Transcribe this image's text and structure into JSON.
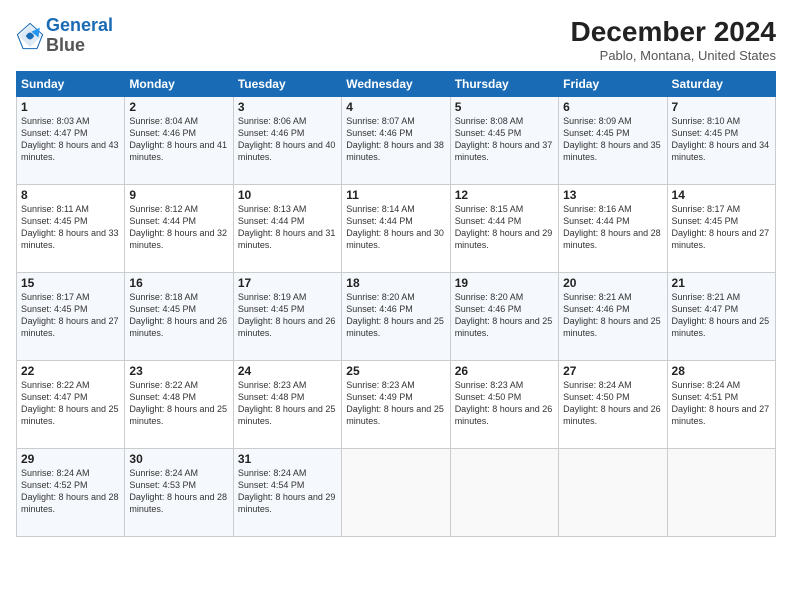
{
  "logo": {
    "line1": "General",
    "line2": "Blue"
  },
  "header": {
    "title": "December 2024",
    "subtitle": "Pablo, Montana, United States"
  },
  "weekdays": [
    "Sunday",
    "Monday",
    "Tuesday",
    "Wednesday",
    "Thursday",
    "Friday",
    "Saturday"
  ],
  "weeks": [
    [
      {
        "day": "1",
        "sunrise": "Sunrise: 8:03 AM",
        "sunset": "Sunset: 4:47 PM",
        "daylight": "Daylight: 8 hours and 43 minutes."
      },
      {
        "day": "2",
        "sunrise": "Sunrise: 8:04 AM",
        "sunset": "Sunset: 4:46 PM",
        "daylight": "Daylight: 8 hours and 41 minutes."
      },
      {
        "day": "3",
        "sunrise": "Sunrise: 8:06 AM",
        "sunset": "Sunset: 4:46 PM",
        "daylight": "Daylight: 8 hours and 40 minutes."
      },
      {
        "day": "4",
        "sunrise": "Sunrise: 8:07 AM",
        "sunset": "Sunset: 4:46 PM",
        "daylight": "Daylight: 8 hours and 38 minutes."
      },
      {
        "day": "5",
        "sunrise": "Sunrise: 8:08 AM",
        "sunset": "Sunset: 4:45 PM",
        "daylight": "Daylight: 8 hours and 37 minutes."
      },
      {
        "day": "6",
        "sunrise": "Sunrise: 8:09 AM",
        "sunset": "Sunset: 4:45 PM",
        "daylight": "Daylight: 8 hours and 35 minutes."
      },
      {
        "day": "7",
        "sunrise": "Sunrise: 8:10 AM",
        "sunset": "Sunset: 4:45 PM",
        "daylight": "Daylight: 8 hours and 34 minutes."
      }
    ],
    [
      {
        "day": "8",
        "sunrise": "Sunrise: 8:11 AM",
        "sunset": "Sunset: 4:45 PM",
        "daylight": "Daylight: 8 hours and 33 minutes."
      },
      {
        "day": "9",
        "sunrise": "Sunrise: 8:12 AM",
        "sunset": "Sunset: 4:44 PM",
        "daylight": "Daylight: 8 hours and 32 minutes."
      },
      {
        "day": "10",
        "sunrise": "Sunrise: 8:13 AM",
        "sunset": "Sunset: 4:44 PM",
        "daylight": "Daylight: 8 hours and 31 minutes."
      },
      {
        "day": "11",
        "sunrise": "Sunrise: 8:14 AM",
        "sunset": "Sunset: 4:44 PM",
        "daylight": "Daylight: 8 hours and 30 minutes."
      },
      {
        "day": "12",
        "sunrise": "Sunrise: 8:15 AM",
        "sunset": "Sunset: 4:44 PM",
        "daylight": "Daylight: 8 hours and 29 minutes."
      },
      {
        "day": "13",
        "sunrise": "Sunrise: 8:16 AM",
        "sunset": "Sunset: 4:44 PM",
        "daylight": "Daylight: 8 hours and 28 minutes."
      },
      {
        "day": "14",
        "sunrise": "Sunrise: 8:17 AM",
        "sunset": "Sunset: 4:45 PM",
        "daylight": "Daylight: 8 hours and 27 minutes."
      }
    ],
    [
      {
        "day": "15",
        "sunrise": "Sunrise: 8:17 AM",
        "sunset": "Sunset: 4:45 PM",
        "daylight": "Daylight: 8 hours and 27 minutes."
      },
      {
        "day": "16",
        "sunrise": "Sunrise: 8:18 AM",
        "sunset": "Sunset: 4:45 PM",
        "daylight": "Daylight: 8 hours and 26 minutes."
      },
      {
        "day": "17",
        "sunrise": "Sunrise: 8:19 AM",
        "sunset": "Sunset: 4:45 PM",
        "daylight": "Daylight: 8 hours and 26 minutes."
      },
      {
        "day": "18",
        "sunrise": "Sunrise: 8:20 AM",
        "sunset": "Sunset: 4:46 PM",
        "daylight": "Daylight: 8 hours and 25 minutes."
      },
      {
        "day": "19",
        "sunrise": "Sunrise: 8:20 AM",
        "sunset": "Sunset: 4:46 PM",
        "daylight": "Daylight: 8 hours and 25 minutes."
      },
      {
        "day": "20",
        "sunrise": "Sunrise: 8:21 AM",
        "sunset": "Sunset: 4:46 PM",
        "daylight": "Daylight: 8 hours and 25 minutes."
      },
      {
        "day": "21",
        "sunrise": "Sunrise: 8:21 AM",
        "sunset": "Sunset: 4:47 PM",
        "daylight": "Daylight: 8 hours and 25 minutes."
      }
    ],
    [
      {
        "day": "22",
        "sunrise": "Sunrise: 8:22 AM",
        "sunset": "Sunset: 4:47 PM",
        "daylight": "Daylight: 8 hours and 25 minutes."
      },
      {
        "day": "23",
        "sunrise": "Sunrise: 8:22 AM",
        "sunset": "Sunset: 4:48 PM",
        "daylight": "Daylight: 8 hours and 25 minutes."
      },
      {
        "day": "24",
        "sunrise": "Sunrise: 8:23 AM",
        "sunset": "Sunset: 4:48 PM",
        "daylight": "Daylight: 8 hours and 25 minutes."
      },
      {
        "day": "25",
        "sunrise": "Sunrise: 8:23 AM",
        "sunset": "Sunset: 4:49 PM",
        "daylight": "Daylight: 8 hours and 25 minutes."
      },
      {
        "day": "26",
        "sunrise": "Sunrise: 8:23 AM",
        "sunset": "Sunset: 4:50 PM",
        "daylight": "Daylight: 8 hours and 26 minutes."
      },
      {
        "day": "27",
        "sunrise": "Sunrise: 8:24 AM",
        "sunset": "Sunset: 4:50 PM",
        "daylight": "Daylight: 8 hours and 26 minutes."
      },
      {
        "day": "28",
        "sunrise": "Sunrise: 8:24 AM",
        "sunset": "Sunset: 4:51 PM",
        "daylight": "Daylight: 8 hours and 27 minutes."
      }
    ],
    [
      {
        "day": "29",
        "sunrise": "Sunrise: 8:24 AM",
        "sunset": "Sunset: 4:52 PM",
        "daylight": "Daylight: 8 hours and 28 minutes."
      },
      {
        "day": "30",
        "sunrise": "Sunrise: 8:24 AM",
        "sunset": "Sunset: 4:53 PM",
        "daylight": "Daylight: 8 hours and 28 minutes."
      },
      {
        "day": "31",
        "sunrise": "Sunrise: 8:24 AM",
        "sunset": "Sunset: 4:54 PM",
        "daylight": "Daylight: 8 hours and 29 minutes."
      },
      null,
      null,
      null,
      null
    ]
  ]
}
